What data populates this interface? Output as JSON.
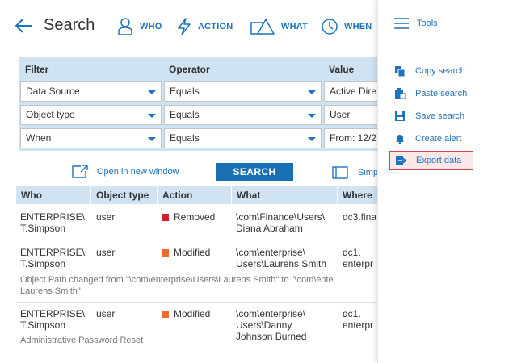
{
  "header": {
    "title": "Search",
    "nav": [
      {
        "label": "WHO"
      },
      {
        "label": "ACTION"
      },
      {
        "label": "WHAT"
      },
      {
        "label": "WHEN"
      }
    ]
  },
  "filters": {
    "headers": [
      "Filter",
      "Operator",
      "Value"
    ],
    "rows": [
      {
        "filter": "Data Source",
        "operator": "Equals",
        "value": "Active Dire"
      },
      {
        "filter": "Object type",
        "operator": "Equals",
        "value": "User"
      },
      {
        "filter": "When",
        "operator": "Equals",
        "value": "From: 12/2"
      }
    ]
  },
  "actions": {
    "open_new_window": "Open in new window",
    "search": "SEARCH",
    "simple": "Simp"
  },
  "results": {
    "headers": [
      "Who",
      "Object type",
      "Action",
      "What",
      "Where"
    ],
    "rows": [
      {
        "who": [
          "ENTERPRISE\\",
          "T.Simpson"
        ],
        "object_type": "user",
        "action": "Removed",
        "action_color": "#d0202c",
        "what": [
          "\\com\\Finance\\Users\\",
          "Diana Abraham"
        ],
        "where": [
          "dc3.fina"
        ],
        "detail": []
      },
      {
        "who": [
          "ENTERPRISE\\",
          "T.Simpson"
        ],
        "object_type": "user",
        "action": "Modified",
        "action_color": "#ee6b2f",
        "what": [
          "\\com\\enterprise\\",
          "Users\\Laurens Smith"
        ],
        "where": [
          "dc1.",
          "enterpr"
        ],
        "detail": [
          "Object Path changed from \"\\com\\enterprise\\Users\\Laurens Smith\" to \"\\com\\ente",
          "Laurens Smith\""
        ]
      },
      {
        "who": [
          "ENTERPRISE\\",
          "T.Simpson"
        ],
        "object_type": "user",
        "action": "Modified",
        "action_color": "#ee6b2f",
        "what": [
          "\\com\\enterprise\\",
          "Users\\Danny",
          "Johnson Burned"
        ],
        "where": [
          "dc1.",
          "enterpr"
        ],
        "detail": [
          "Administrative Password Reset"
        ]
      }
    ]
  },
  "tools": {
    "title": "Tools",
    "items": [
      {
        "label": "Copy search"
      },
      {
        "label": "Paste search"
      },
      {
        "label": "Save search"
      },
      {
        "label": "Create alert"
      },
      {
        "label": "Export data"
      }
    ]
  },
  "colors": {
    "accent": "#1e73be",
    "header_bg": "#cfe3f3",
    "search_button": "#1a6fb5",
    "highlight_border": "#d9414f"
  }
}
